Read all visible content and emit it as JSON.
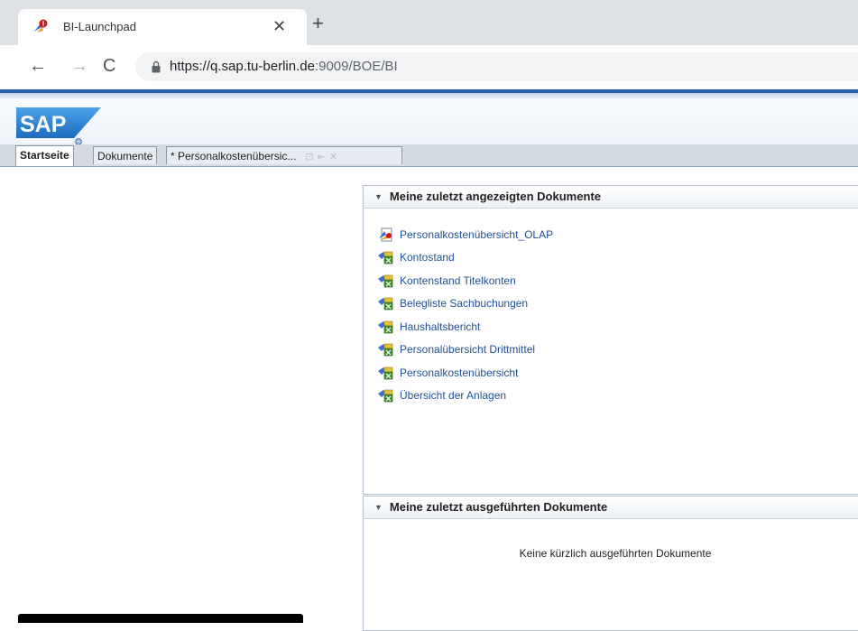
{
  "browser": {
    "tab_title": "BI-Launchpad",
    "tab_close_icon": "close-icon",
    "new_tab_icon": "plus-icon",
    "url_host": "https://q.sap.tu-berlin.de",
    "url_path": ":9009/BOE/BI"
  },
  "sap": {
    "logo_text": "SAP",
    "tabs": [
      {
        "label": "Startseite",
        "active": true
      },
      {
        "label": "Dokumente",
        "active": false
      },
      {
        "label": "* Personalkostenübersic...",
        "active": false
      }
    ]
  },
  "recent_viewed": {
    "title": "Meine zuletzt angezeigten Dokumente",
    "items": [
      {
        "label": "Personalkostenübersicht_OLAP",
        "icon": "olap-document-icon"
      },
      {
        "label": "Kontostand",
        "icon": "webi-document-icon"
      },
      {
        "label": "Kontenstand Titelkonten",
        "icon": "webi-document-icon"
      },
      {
        "label": "Belegliste Sachbuchungen",
        "icon": "webi-document-icon"
      },
      {
        "label": "Haushaltsbericht",
        "icon": "webi-document-icon"
      },
      {
        "label": "Personalübersicht Drittmittel",
        "icon": "webi-document-icon"
      },
      {
        "label": "Personalkostenübersicht",
        "icon": "webi-document-icon"
      },
      {
        "label": "Übersicht der Anlagen",
        "icon": "webi-document-icon"
      }
    ]
  },
  "recent_run": {
    "title": "Meine zuletzt ausgeführten Dokumente",
    "empty_message": "Keine kürzlich ausgeführten Dokumente"
  },
  "colors": {
    "sap_blue": "#2b5fa7",
    "link": "#1f4f96"
  }
}
